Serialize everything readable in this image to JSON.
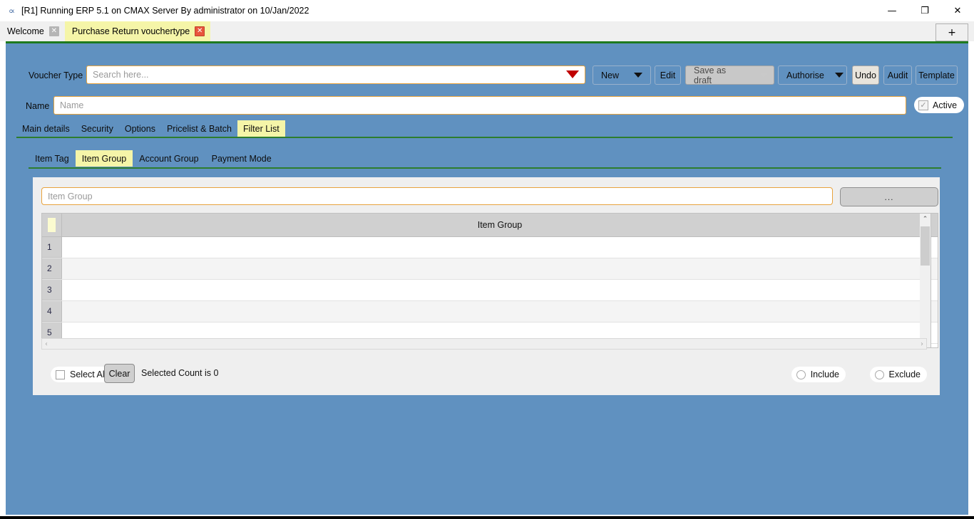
{
  "window": {
    "title": "[R1] Running ERP 5.1 on CMAX Server By administrator on 10/Jan/2022",
    "app_icon": "cx",
    "minimize": "—",
    "maximize": "❐",
    "close": "✕"
  },
  "tabstrip": {
    "tabs": [
      {
        "label": "Welcome",
        "close": "✕",
        "active": false
      },
      {
        "label": "Purchase Return vouchertype",
        "close": "✕",
        "active": true
      }
    ],
    "new_tab": "+"
  },
  "form": {
    "voucher_type_label": "Voucher Type",
    "voucher_type_placeholder": "Search here...",
    "voucher_type_value": "",
    "name_label": "Name",
    "name_placeholder": "Name",
    "name_value": "",
    "active_label": "Active",
    "active_checked_glyph": "✓"
  },
  "toolbar": {
    "new_label": "New",
    "edit_label": "Edit",
    "save_draft_label": "Save as draft",
    "authorise_label": "Authorise",
    "undo_label": "Undo",
    "audit_label": "Audit",
    "template_label": "Template"
  },
  "tabs_primary": [
    {
      "label": "Main details",
      "selected": false
    },
    {
      "label": "Security",
      "selected": false
    },
    {
      "label": "Options",
      "selected": false
    },
    {
      "label": "Pricelist & Batch",
      "selected": false
    },
    {
      "label": "Filter List",
      "selected": true
    }
  ],
  "tabs_secondary": [
    {
      "label": "Item Tag",
      "selected": false
    },
    {
      "label": "Item Group",
      "selected": true
    },
    {
      "label": "Account Group",
      "selected": false
    },
    {
      "label": "Payment Mode",
      "selected": false
    }
  ],
  "panel": {
    "search_placeholder": "Item Group",
    "search_value": "",
    "browse_label": "...",
    "grid": {
      "column_header": "Item Group",
      "rows": [
        {
          "num": "1",
          "value": ""
        },
        {
          "num": "2",
          "value": ""
        },
        {
          "num": "3",
          "value": ""
        },
        {
          "num": "4",
          "value": ""
        },
        {
          "num": "5",
          "value": ""
        }
      ]
    },
    "footer": {
      "select_all_label": "Select All",
      "clear_label": "Clear",
      "selected_count_text": "Selected Count is 0",
      "include_label": "Include",
      "exclude_label": "Exclude"
    },
    "scroll": {
      "up": "⌃",
      "down": "⌄",
      "left": "‹",
      "right": "›"
    }
  },
  "colors": {
    "app_background": "#6091c0",
    "accent_tab": "#f5f5a8",
    "field_border": "#e8a33d",
    "rule_green": "#2d7d2d",
    "caret_red": "#c00000"
  }
}
